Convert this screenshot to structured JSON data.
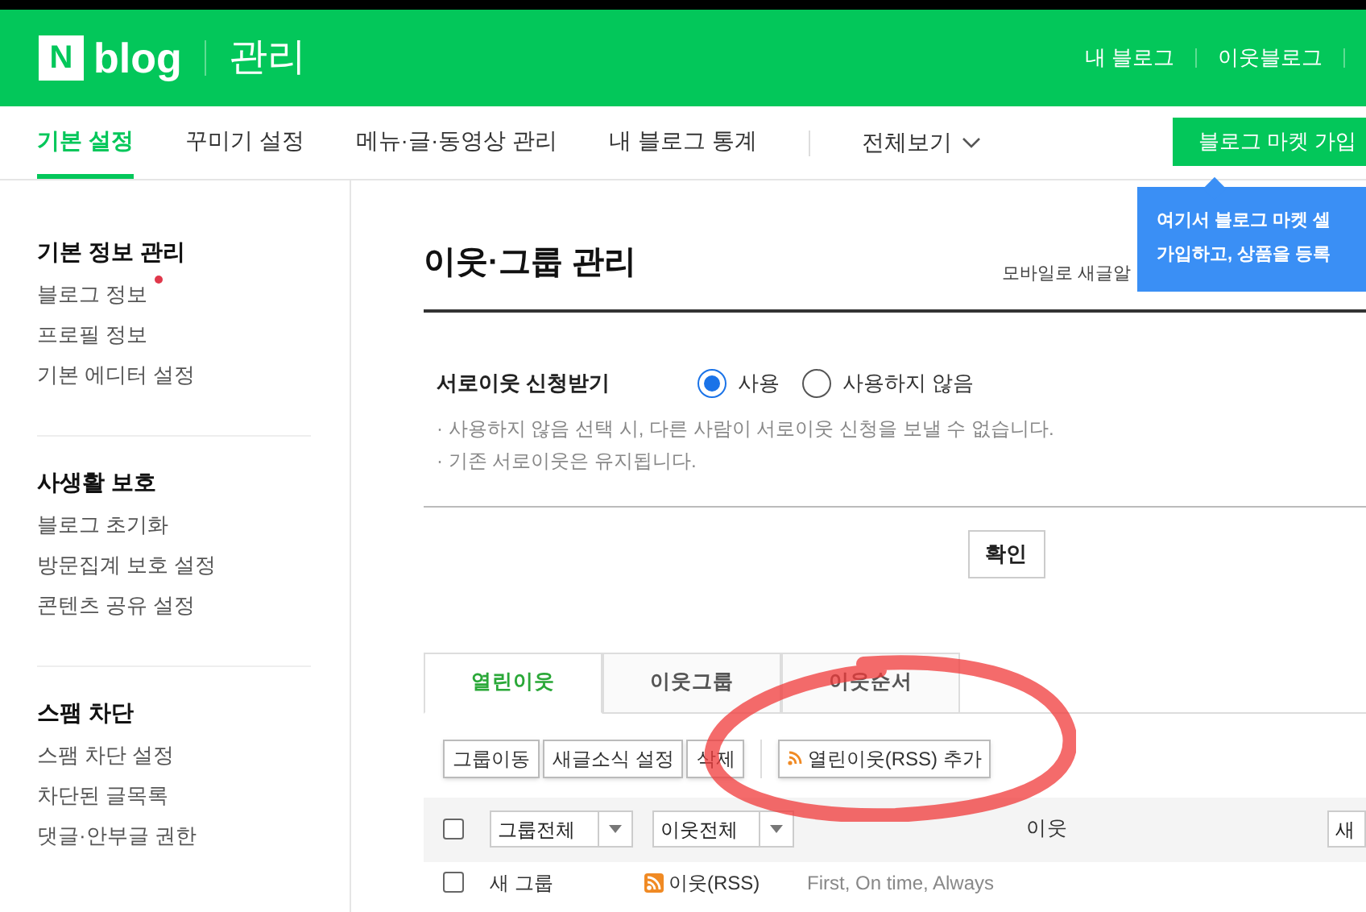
{
  "header": {
    "logo_mark": "N",
    "logo_text": "blog",
    "title": "관리",
    "links": [
      "내 블로그",
      "이웃블로그"
    ]
  },
  "nav": {
    "items": [
      {
        "label": "기본 설정",
        "selected": true
      },
      {
        "label": "꾸미기 설정",
        "selected": false
      },
      {
        "label": "메뉴·글·동영상 관리",
        "selected": false
      },
      {
        "label": "내 블로그 통계",
        "selected": false
      }
    ],
    "all_view": "전체보기",
    "market_button": "블로그 마켓 가입"
  },
  "tooltip": {
    "lines": [
      "여기서 블로그 마켓 셀",
      "가입하고, 상품을 등록"
    ]
  },
  "sidebar": {
    "sections": [
      {
        "title": "기본 정보 관리",
        "items": [
          {
            "label": "블로그 정보",
            "new": true
          },
          {
            "label": "프로필 정보",
            "new": false
          },
          {
            "label": "기본 에디터 설정",
            "new": false
          }
        ]
      },
      {
        "title": "사생활 보호",
        "items": [
          {
            "label": "블로그 초기화",
            "new": false
          },
          {
            "label": "방문집계 보호 설정",
            "new": false
          },
          {
            "label": "콘텐츠 공유 설정",
            "new": false
          }
        ]
      },
      {
        "title": "스팸 차단",
        "items": [
          {
            "label": "스팸 차단 설정",
            "new": false
          },
          {
            "label": "차단된 글목록",
            "new": false
          },
          {
            "label": "댓글·안부글 권한",
            "new": false
          }
        ]
      }
    ]
  },
  "main": {
    "title": "이웃·그룹 관리",
    "mobile_note": "모바일로 새글알",
    "setting": {
      "label": "서로이웃 신청받기",
      "options": [
        {
          "label": "사용",
          "selected": true
        },
        {
          "label": "사용하지 않음",
          "selected": false
        }
      ],
      "notes": [
        "· 사용하지 않음 선택 시, 다른 사람이 서로이웃 신청을 보낼 수 없습니다.",
        "· 기존 서로이웃은 유지됩니다."
      ]
    },
    "confirm_button": "확인",
    "tabs": [
      {
        "label": "열린이웃",
        "selected": true
      },
      {
        "label": "이웃그룹",
        "selected": false
      },
      {
        "label": "이웃순서",
        "selected": false
      }
    ],
    "actions": [
      "그룹이동",
      "새글소식 설정",
      "삭제"
    ],
    "rss_button": "열린이웃(RSS) 추가",
    "table": {
      "checked": false,
      "group_filter": "그룹전체",
      "neighbor_filter": "이웃전체",
      "column_label": "이웃",
      "column_4": "새",
      "rows": [
        {
          "checked": false,
          "group": "새 그룹",
          "neighbor": "이웃(RSS)",
          "description": "First, On time, Always"
        }
      ]
    }
  }
}
